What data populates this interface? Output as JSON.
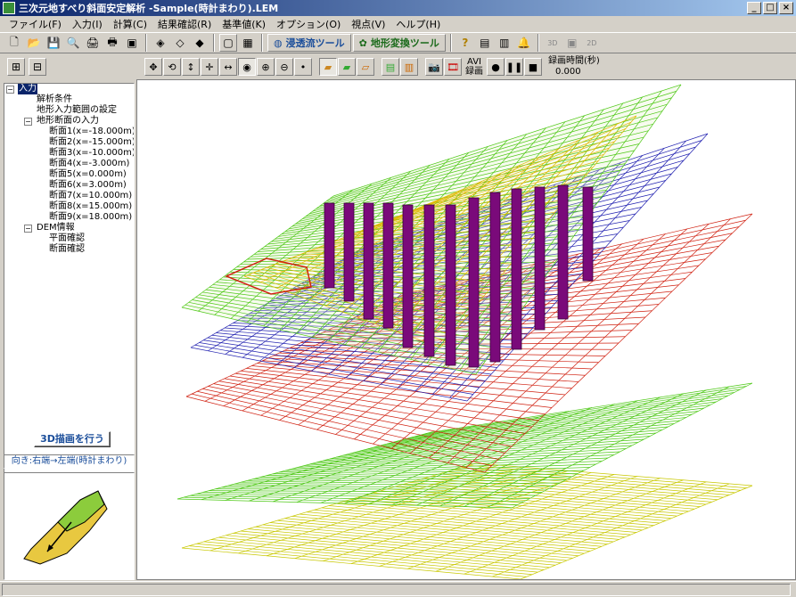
{
  "window": {
    "title": "三次元地すべり斜面安定解析 -Sample(時計まわり).LEM"
  },
  "menu": [
    "ファイル(F)",
    "入力(I)",
    "計算(C)",
    "結果確認(R)",
    "基準値(K)",
    "オプション(O)",
    "視点(V)",
    "ヘルプ(H)"
  ],
  "toolbar": {
    "seepage_label": "浸透流ツール",
    "terrain_label": "地形変換ツール",
    "icon_3d": "3D",
    "icon_2d": "2D"
  },
  "view_toolbar": {
    "avi_label": "AVI",
    "record_label": "録画",
    "rec_time_label": "録画時間(秒)",
    "rec_time_value": "0.000"
  },
  "tree": {
    "root": "入力",
    "items": [
      "解析条件",
      "地形入力範囲の設定"
    ],
    "section_group": "地形断面の入力",
    "sections": [
      "断面1(x=-18.000m)",
      "断面2(x=-15.000m)",
      "断面3(x=-10.000m)",
      "断面4(x=-3.000m)",
      "断面5(x=0.000m)",
      "断面6(x=3.000m)",
      "断面7(x=10.000m)",
      "断面8(x=15.000m)",
      "断面9(x=18.000m)"
    ],
    "dem_group": "DEM情報",
    "dem_items": [
      "平面確認",
      "断面確認"
    ]
  },
  "panel": {
    "draw_button": "3D描画を行う",
    "direction": "向き:右端→左端(時計まわり)"
  },
  "colors": {
    "title_start": "#0a246a",
    "title_end": "#a6caf0",
    "green_mesh": "#4cc814",
    "red_mesh": "#d02010",
    "blue_mesh": "#2020b0",
    "yellow_mesh": "#c8c800",
    "pile": "#7a0a7a"
  }
}
